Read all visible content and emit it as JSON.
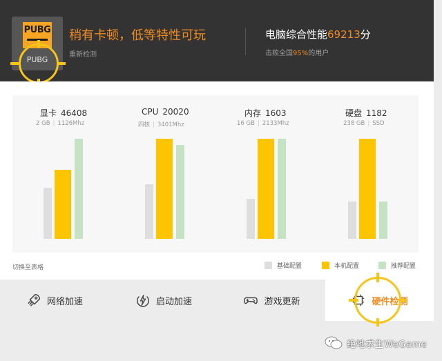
{
  "header": {
    "game_logo_text": "PUBG",
    "game_name": "PUBG",
    "status_title": "稍有卡顿，低等特性可玩",
    "recheck_label": "重新检测",
    "perf_title_prefix": "电脑综合性能",
    "perf_score": "69213",
    "perf_title_suffix": "分",
    "perf_sub_prefix": "击败全国",
    "perf_sub_pct": "95%",
    "perf_sub_suffix": "的用户"
  },
  "hardware": [
    {
      "name": "显卡",
      "score": "46408",
      "spec1": "2 GB",
      "spec2": "1126Mhz",
      "base": 0.47,
      "local": 0.63,
      "rec": 0.92
    },
    {
      "name": "CPU",
      "score": "20020",
      "spec1": "四核",
      "spec2": "3401Mhz",
      "base": 0.5,
      "local": 0.92,
      "rec": 0.86
    },
    {
      "name": "内存",
      "score": "1603",
      "spec1": "16 GB",
      "spec2": "2133Mhz",
      "base": 0.37,
      "local": 0.92,
      "rec": 0.92
    },
    {
      "name": "硬盘",
      "score": "1182",
      "spec1": "238 GB",
      "spec2": "SSD",
      "base": 0.34,
      "local": 0.92,
      "rec": 0.34
    }
  ],
  "footer": {
    "switch_label": "切换至表格",
    "legend": [
      {
        "label": "基础配置",
        "color": "#dedede"
      },
      {
        "label": "本机配置",
        "color": "#fcc500"
      },
      {
        "label": "推荐配置",
        "color": "#c6e2c4"
      }
    ]
  },
  "tabs": [
    {
      "label": "网络加速",
      "icon": "rocket-icon"
    },
    {
      "label": "启动加速",
      "icon": "lightning-icon"
    },
    {
      "label": "游戏更新",
      "icon": "gamepad-icon"
    },
    {
      "label": "硬件检测",
      "icon": "chip-icon"
    }
  ],
  "watermark": "绝地求生WeGame",
  "colors": {
    "accent": "#f18b1f",
    "header_bg": "#333333",
    "highlight": "#f5c518"
  }
}
